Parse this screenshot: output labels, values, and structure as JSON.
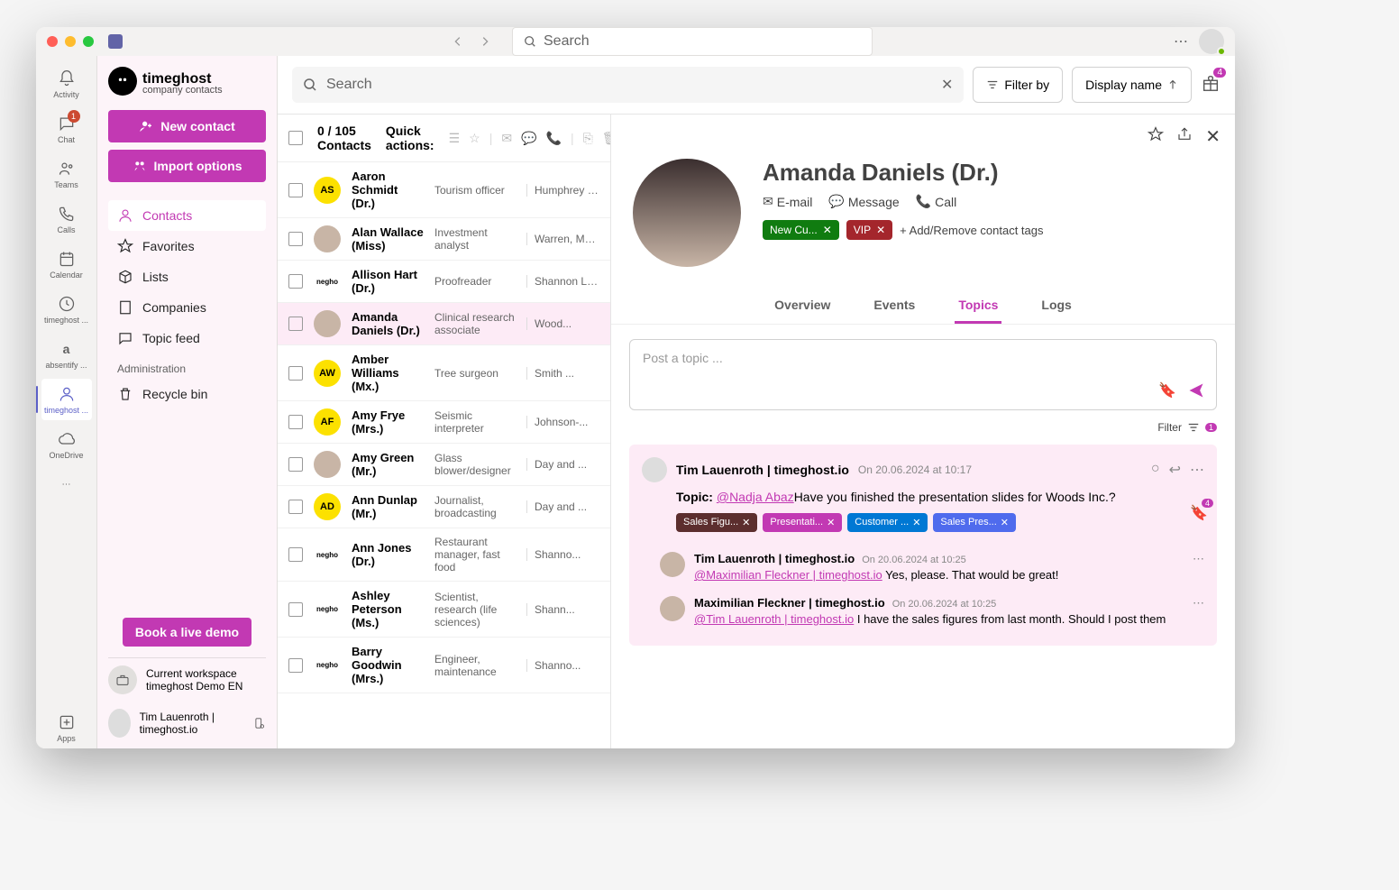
{
  "titlebar": {
    "search_placeholder": "Search"
  },
  "rail": {
    "items": [
      {
        "label": "Activity",
        "icon": "bell"
      },
      {
        "label": "Chat",
        "icon": "chat",
        "badge": "1"
      },
      {
        "label": "Teams",
        "icon": "teams"
      },
      {
        "label": "Calls",
        "icon": "phone"
      },
      {
        "label": "Calendar",
        "icon": "calendar"
      },
      {
        "label": "timeghost ...",
        "icon": "tg1"
      },
      {
        "label": "absentify ...",
        "icon": "a"
      },
      {
        "label": "timeghost ...",
        "icon": "tg2",
        "active": true
      },
      {
        "label": "OneDrive",
        "icon": "cloud"
      }
    ],
    "apps": "Apps"
  },
  "sidebar": {
    "brand": "timeghost",
    "brand_sub": "company contacts",
    "new_contact": "New contact",
    "import": "Import options",
    "nav": [
      {
        "label": "Contacts",
        "active": true
      },
      {
        "label": "Favorites"
      },
      {
        "label": "Lists"
      },
      {
        "label": "Companies"
      },
      {
        "label": "Topic feed"
      }
    ],
    "admin_label": "Administration",
    "recycle": "Recycle bin",
    "book_demo": "Book a live demo",
    "workspace_label": "Current workspace",
    "workspace_name": "timeghost Demo EN",
    "user": "Tim Lauenroth | timeghost.io"
  },
  "toolbar": {
    "search_placeholder": "Search",
    "filter_by": "Filter by",
    "sort": "Display name",
    "gift_count": "4"
  },
  "list": {
    "count_label": "0 / 105 Contacts",
    "quick_label": "Quick actions:",
    "contacts": [
      {
        "initials": "AS",
        "avatar": "yellow",
        "name": "Aaron Schmidt (Dr.)",
        "job": "Tourism officer",
        "company": "Humphrey an..."
      },
      {
        "avatar": "img",
        "name": "Alan Wallace (Miss)",
        "job": "Investment analyst",
        "company": "Warren, Maldonad..."
      },
      {
        "company_logo": "negho",
        "name": "Allison Hart (Dr.)",
        "job": "Proofreader",
        "company": "Shannon LLC"
      },
      {
        "avatar": "img",
        "name": "Amanda Daniels (Dr.)",
        "job": "Clinical research associate",
        "company": "Wood...",
        "selected": true
      },
      {
        "initials": "AW",
        "avatar": "yellow",
        "name": "Amber Williams (Mx.)",
        "job": "Tree surgeon",
        "company": "Smith ..."
      },
      {
        "initials": "AF",
        "avatar": "yellow",
        "name": "Amy Frye (Mrs.)",
        "job": "Seismic interpreter",
        "company": "Johnson-..."
      },
      {
        "avatar": "img",
        "name": "Amy Green (Mr.)",
        "job": "Glass blower/designer",
        "company": "Day and ..."
      },
      {
        "initials": "AD",
        "avatar": "yellow",
        "name": "Ann Dunlap (Mr.)",
        "job": "Journalist, broadcasting",
        "company": "Day and ..."
      },
      {
        "company_logo": "negho",
        "name": "Ann Jones (Dr.)",
        "job": "Restaurant manager, fast food",
        "company": "Shanno..."
      },
      {
        "company_logo": "negho",
        "name": "Ashley Peterson (Ms.)",
        "job": "Scientist, research (life sciences)",
        "company": "Shann..."
      },
      {
        "company_logo": "negho",
        "name": "Barry Goodwin (Mrs.)",
        "job": "Engineer, maintenance",
        "company": "Shanno..."
      }
    ]
  },
  "detail": {
    "name": "Amanda Daniels (Dr.)",
    "actions": {
      "email": "E-mail",
      "message": "Message",
      "call": "Call"
    },
    "tags": [
      {
        "label": "New Cu...",
        "color": "#107c10"
      },
      {
        "label": "VIP",
        "color": "#a4262c"
      }
    ],
    "add_tag": "+ Add/Remove contact tags",
    "tabs": [
      "Overview",
      "Events",
      "Topics",
      "Logs"
    ],
    "active_tab": "Topics",
    "compose_placeholder": "Post a topic ...",
    "filter_label": "Filter",
    "filter_count": "1",
    "topic": {
      "author": "Tim Lauenroth | timeghost.io",
      "time": "On 20.06.2024 at 10:17",
      "prefix": "Topic:",
      "mention": "@Nadja Abaz",
      "text": "Have you finished the presentation slides for Woods Inc.?",
      "chips": [
        {
          "label": "Sales Figu...",
          "color": "#5c2e2e"
        },
        {
          "label": "Presentati...",
          "color": "#c239b3"
        },
        {
          "label": "Customer ...",
          "color": "#0078d4"
        },
        {
          "label": "Sales Pres...",
          "color": "#4f6bed"
        }
      ],
      "chip_badge": "4",
      "replies": [
        {
          "author": "Tim Lauenroth | timeghost.io",
          "time": "On 20.06.2024 at 10:25",
          "mention": "@Maximilian Fleckner | timeghost.io",
          "text": " Yes, please. That would be great!"
        },
        {
          "author": "Maximilian Fleckner | timeghost.io",
          "time": "On 20.06.2024 at 10:25",
          "mention": "@Tim Lauenroth | timeghost.io",
          "text": " I have the sales figures from last month. Should I post them"
        }
      ]
    }
  }
}
